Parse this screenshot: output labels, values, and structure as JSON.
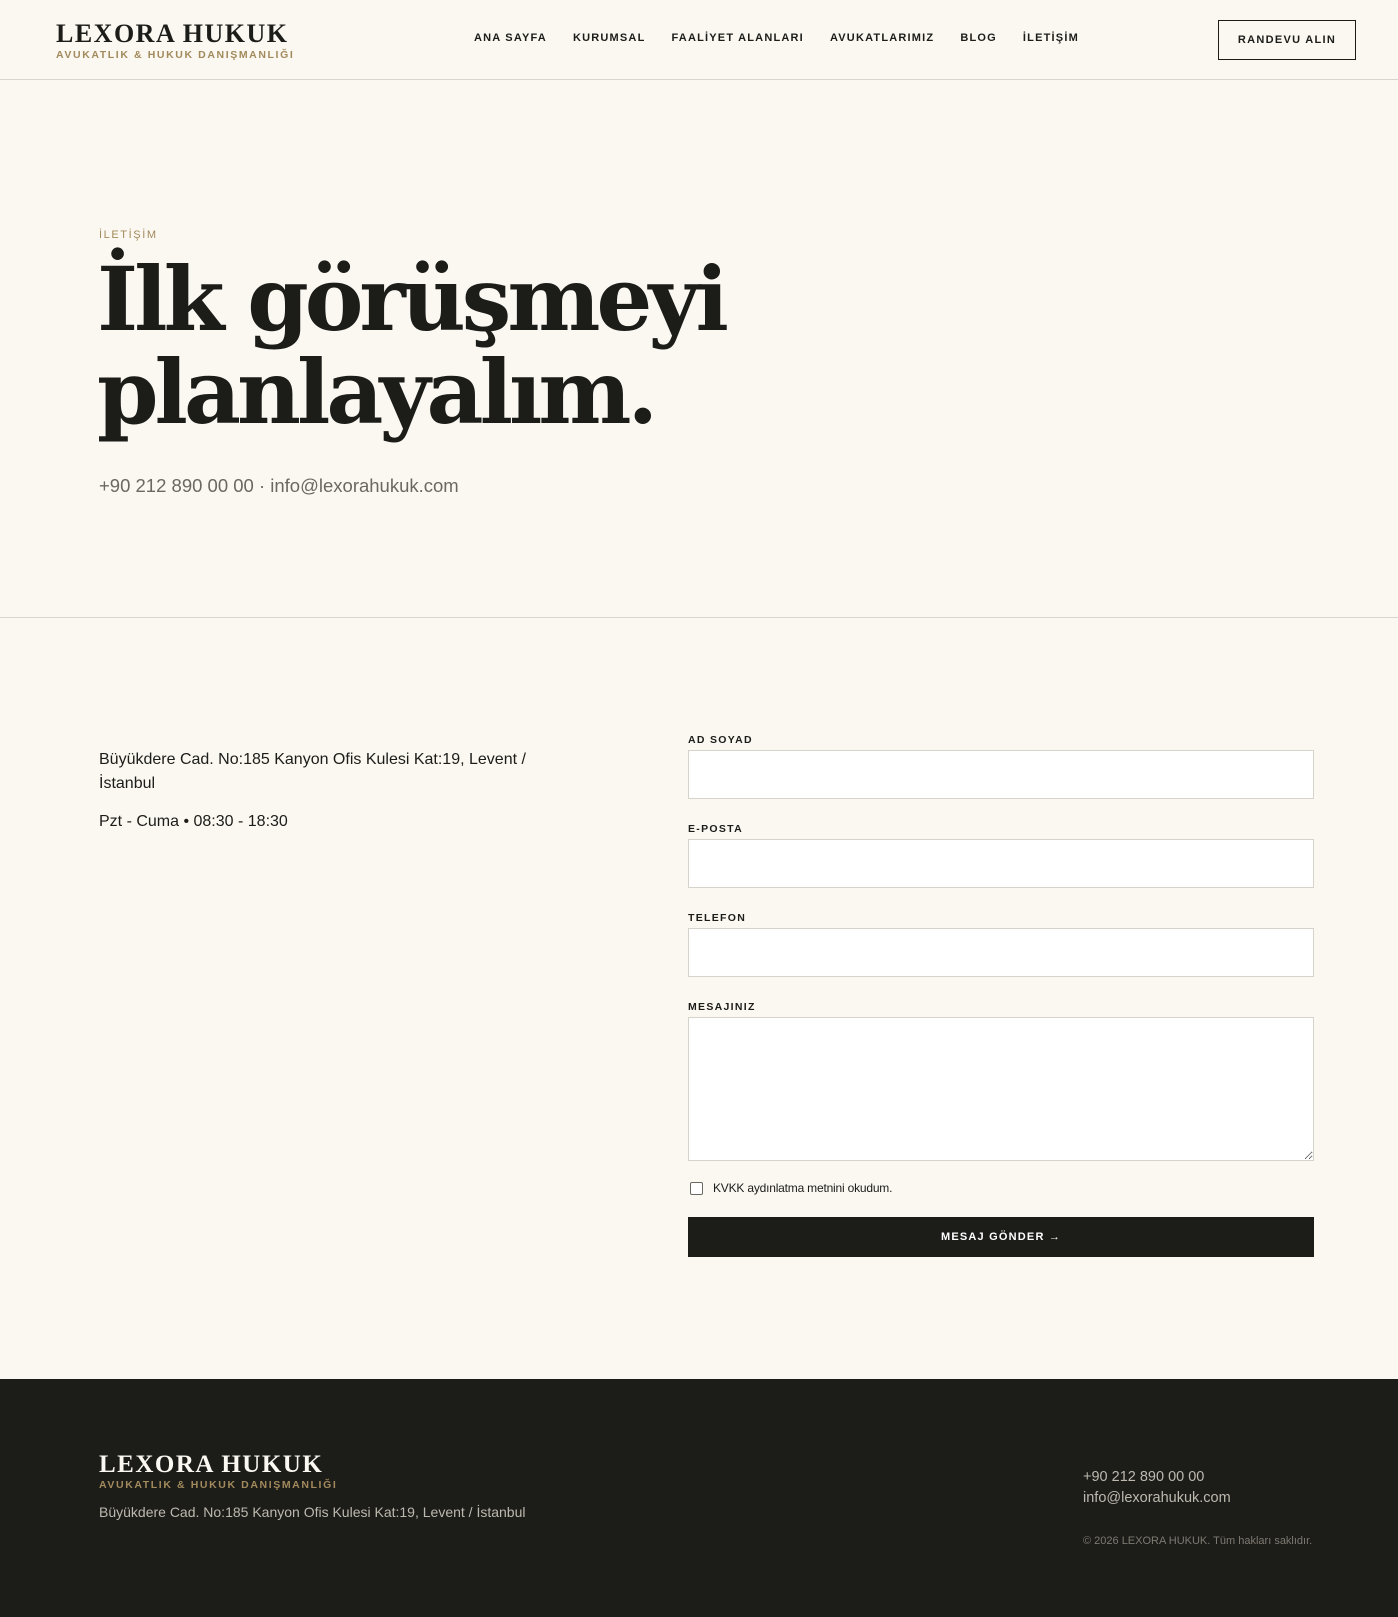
{
  "header": {
    "brand_name": "LEXORA HUKUK",
    "brand_sub": "AVUKATLIK & HUKUK DANIŞMANLIĞI",
    "nav": [
      "ANA SAYFA",
      "KURUMSAL",
      "FAALİYET ALANLARI",
      "AVUKATLARIMIZ",
      "BLOG",
      "İLETİŞİM"
    ],
    "cta_label": "RANDEVU ALIN"
  },
  "hero": {
    "eyebrow": "İLETİŞİM",
    "title_line1": "İlk görüşmeyi",
    "title_line2": "planlayalım.",
    "contact": "+90 212 890 00 00 · info@lexorahukuk.com"
  },
  "contact": {
    "address": "Büyükdere Cad. No:185 Kanyon Ofis Kulesi Kat:19, Levent / İstanbul",
    "hours": "Pzt - Cuma • 08:30 - 18:30"
  },
  "form": {
    "name_label": "AD SOYAD",
    "email_label": "E-POSTA",
    "phone_label": "TELEFON",
    "message_label": "MESAJINIZ",
    "consent_text": "KVKK aydınlatma metnini okudum.",
    "submit_label": "MESAJ GÖNDER →"
  },
  "footer": {
    "brand_name": "LEXORA HUKUK",
    "brand_sub": "AVUKATLIK & HUKUK DANIŞMANLIĞI",
    "address": "Büyükdere Cad. No:185 Kanyon Ofis Kulesi Kat:19, Levent / İstanbul",
    "phone": "+90 212 890 00 00",
    "email": "info@lexorahukuk.com",
    "copyright": "© 2026 LEXORA HUKUK. Tüm hakları saklıdır."
  },
  "colors": {
    "background": "#fbf8f1",
    "ink": "#1c1c19",
    "accent_gold": "#a28a5c",
    "footer_bg": "#1c1c19"
  }
}
